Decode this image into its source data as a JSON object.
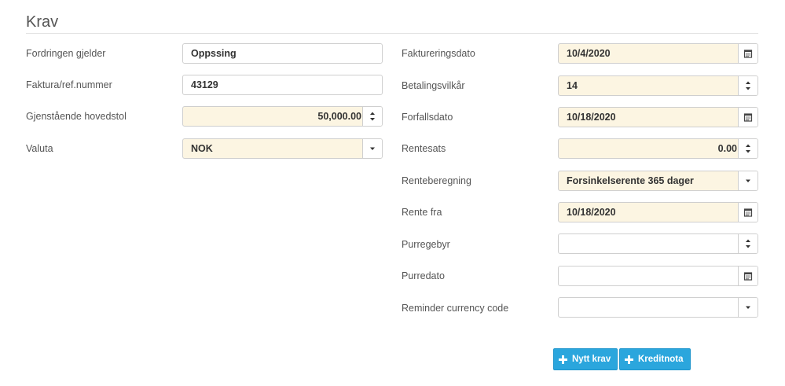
{
  "section": {
    "title": "Krav"
  },
  "left": [
    {
      "label": "Fordringen gjelder",
      "value": "Oppssing"
    },
    {
      "label": "Faktura/ref.nummer",
      "value": "43129"
    },
    {
      "label": "Gjenstående hovedstol",
      "value": "50,000.00"
    },
    {
      "label": "Valuta",
      "value": "NOK"
    }
  ],
  "right": [
    {
      "label": "Faktureringsdato",
      "value": "10/4/2020",
      "icon": "calendar-icon"
    },
    {
      "label": "Betalingsvilkår",
      "value": "14",
      "icon": "spinner-icon"
    },
    {
      "label": "Forfallsdato",
      "value": "10/18/2020",
      "icon": "calendar-icon"
    },
    {
      "label": "Rentesats",
      "value": "0.00",
      "icon": "spinner-icon"
    },
    {
      "label": "Renteberegning",
      "value": "Forsinkelserente 365 dager",
      "icon": "caret-down-icon"
    },
    {
      "label": "Rente fra",
      "value": "10/18/2020",
      "icon": "calendar-icon"
    },
    {
      "label": "Purregebyr",
      "value": "",
      "icon": "spinner-icon"
    },
    {
      "label": "Purredato",
      "value": "",
      "icon": "calendar-icon"
    },
    {
      "label": "Reminder currency code",
      "value": "",
      "icon": "caret-down-icon"
    }
  ],
  "buttons": {
    "new_claim": "Nytt krav",
    "credit_note": "Kreditnota"
  },
  "colors": {
    "filled_bg": "#fcf5e2",
    "button_bg": "#2ba6dd",
    "border": "#cfcfcf"
  }
}
